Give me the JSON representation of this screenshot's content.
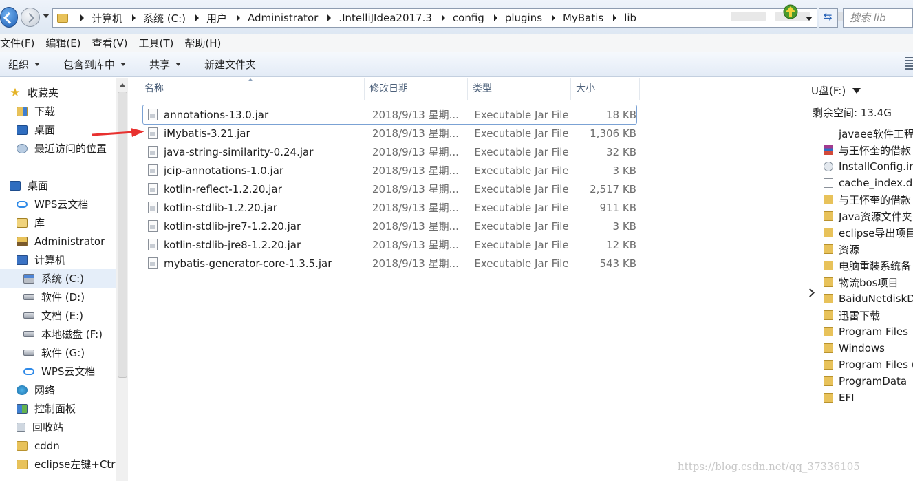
{
  "address_bar": {
    "breadcrumbs": [
      "计算机",
      "系统 (C:)",
      "用户",
      "Administrator",
      ".IntelliJIdea2017.3",
      "config",
      "plugins",
      "MyBatis",
      "lib"
    ],
    "search_placeholder": "搜索 lib"
  },
  "menu": {
    "items": [
      "文件(F)",
      "编辑(E)",
      "查看(V)",
      "工具(T)",
      "帮助(H)"
    ]
  },
  "toolbar": {
    "organize": "组织",
    "include_in_library": "包含到库中",
    "share": "共享",
    "new_folder": "新建文件夹"
  },
  "nav_pane": {
    "favorites": [
      "收藏夹",
      "下载",
      "桌面",
      "最近访问的位置"
    ],
    "tree": [
      {
        "label": "桌面",
        "icon": "desktop-icon"
      },
      {
        "label": "WPS云文档",
        "icon": "cloud-icon"
      },
      {
        "label": "库",
        "icon": "library-icon"
      },
      {
        "label": "Administrator",
        "icon": "user-folder-icon"
      },
      {
        "label": "计算机",
        "icon": "computer-icon"
      },
      {
        "label": "系统 (C:)",
        "icon": "system-drive-icon",
        "selected": true
      },
      {
        "label": "软件 (D:)",
        "icon": "drive-icon"
      },
      {
        "label": "文档 (E:)",
        "icon": "drive-icon"
      },
      {
        "label": "本地磁盘 (F:)",
        "icon": "drive-icon"
      },
      {
        "label": "软件 (G:)",
        "icon": "drive-icon"
      },
      {
        "label": "WPS云文档",
        "icon": "cloud-icon"
      },
      {
        "label": "网络",
        "icon": "network-icon"
      },
      {
        "label": "控制面板",
        "icon": "control-panel-icon"
      },
      {
        "label": "回收站",
        "icon": "recycle-bin-icon"
      },
      {
        "label": "cddn",
        "icon": "folder-icon"
      },
      {
        "label": "eclipse左键+Ctrl",
        "icon": "folder-icon"
      }
    ]
  },
  "file_list": {
    "columns": {
      "name": "名称",
      "date": "修改日期",
      "type": "类型",
      "size": "大小"
    },
    "rows": [
      {
        "name": "annotations-13.0.jar",
        "date": "2018/9/13 星期...",
        "type": "Executable Jar File",
        "size": "18 KB"
      },
      {
        "name": "iMybatis-3.21.jar",
        "date": "2018/9/13 星期...",
        "type": "Executable Jar File",
        "size": "1,306 KB"
      },
      {
        "name": "java-string-similarity-0.24.jar",
        "date": "2018/9/13 星期...",
        "type": "Executable Jar File",
        "size": "32 KB"
      },
      {
        "name": "jcip-annotations-1.0.jar",
        "date": "2018/9/13 星期...",
        "type": "Executable Jar File",
        "size": "3 KB"
      },
      {
        "name": "kotlin-reflect-1.2.20.jar",
        "date": "2018/9/13 星期...",
        "type": "Executable Jar File",
        "size": "2,517 KB"
      },
      {
        "name": "kotlin-stdlib-1.2.20.jar",
        "date": "2018/9/13 星期...",
        "type": "Executable Jar File",
        "size": "911 KB"
      },
      {
        "name": "kotlin-stdlib-jre7-1.2.20.jar",
        "date": "2018/9/13 星期...",
        "type": "Executable Jar File",
        "size": "3 KB"
      },
      {
        "name": "kotlin-stdlib-jre8-1.2.20.jar",
        "date": "2018/9/13 星期...",
        "type": "Executable Jar File",
        "size": "12 KB"
      },
      {
        "name": "mybatis-generator-core-1.3.5.jar",
        "date": "2018/9/13 星期...",
        "type": "Executable Jar File",
        "size": "543 KB"
      }
    ]
  },
  "right_pane": {
    "drive": "U盘(F:)",
    "free_space": "剩余空间: 13.4G",
    "items": [
      {
        "label": "javaee软件工程",
        "icon": "word-doc-icon"
      },
      {
        "label": "与王怀奎的借款",
        "icon": "rar-archive-icon"
      },
      {
        "label": "InstallConfig.ini",
        "icon": "ini-file-icon"
      },
      {
        "label": "cache_index.db",
        "icon": "db-file-icon"
      },
      {
        "label": "与王怀奎的借款",
        "icon": "folder-icon"
      },
      {
        "label": "Java资源文件夹",
        "icon": "folder-icon"
      },
      {
        "label": "eclipse导出项目",
        "icon": "folder-icon"
      },
      {
        "label": "资源",
        "icon": "folder-icon"
      },
      {
        "label": "电脑重装系统备",
        "icon": "folder-icon"
      },
      {
        "label": "物流bos项目",
        "icon": "folder-icon"
      },
      {
        "label": "BaiduNetdiskDo",
        "icon": "folder-icon"
      },
      {
        "label": "迅雷下载",
        "icon": "folder-icon"
      },
      {
        "label": "Program Files",
        "icon": "folder-icon"
      },
      {
        "label": "Windows",
        "icon": "folder-icon"
      },
      {
        "label": "Program Files (",
        "icon": "folder-icon"
      },
      {
        "label": "ProgramData",
        "icon": "folder-icon"
      },
      {
        "label": "EFI",
        "icon": "folder-icon"
      }
    ]
  },
  "watermark": "https://blog.csdn.net/qq_37336105",
  "colors": {
    "accent": "#2f6dbf",
    "annotation_arrow": "#e8312f"
  }
}
